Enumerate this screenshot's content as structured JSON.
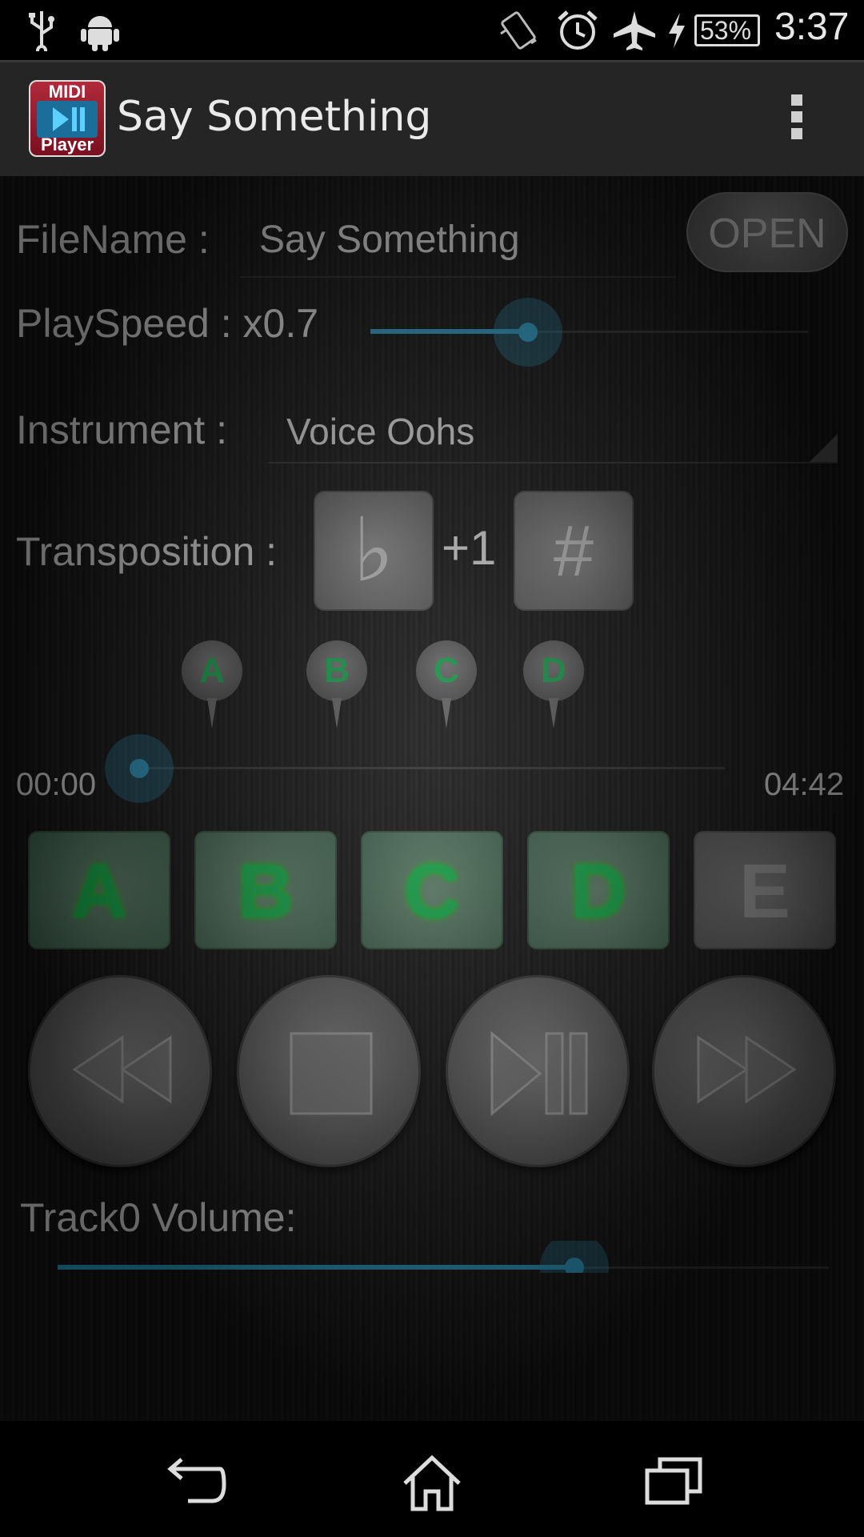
{
  "status_bar": {
    "icons": [
      "usb-icon",
      "android-debug-icon",
      "vibrate-icon",
      "alarm-icon",
      "airplane-icon",
      "charging-icon"
    ],
    "battery": "53%",
    "time": "3:37"
  },
  "action_bar": {
    "app_icon_top": "MIDI",
    "app_icon_bottom": "Player",
    "title": "Say Something"
  },
  "file": {
    "label": "FileName :",
    "value": "Say Something",
    "open_button": "OPEN"
  },
  "speed": {
    "label": "PlaySpeed : x0.7",
    "level": 0.36
  },
  "instrument": {
    "label": "Instrument :",
    "value": "Voice Oohs"
  },
  "transposition": {
    "label": "Transposition :",
    "flat_symbol": "♭",
    "value": "+1",
    "sharp_symbol": "#"
  },
  "markers": [
    "A",
    "B",
    "C",
    "D"
  ],
  "progress": {
    "current": "00:00",
    "total": "04:42",
    "level": 0.0
  },
  "section_buttons": [
    {
      "label": "A",
      "active": true
    },
    {
      "label": "B",
      "active": true
    },
    {
      "label": "C",
      "active": true
    },
    {
      "label": "D",
      "active": true
    },
    {
      "label": "E",
      "active": false
    }
  ],
  "transport": [
    "rewind-icon",
    "stop-icon",
    "play-pause-icon",
    "fast-forward-icon"
  ],
  "track_volume": {
    "label": "Track0 Volume:",
    "level": 0.67
  },
  "colors": {
    "accent": "#33b5e5",
    "marker_green": "#19c45a"
  }
}
